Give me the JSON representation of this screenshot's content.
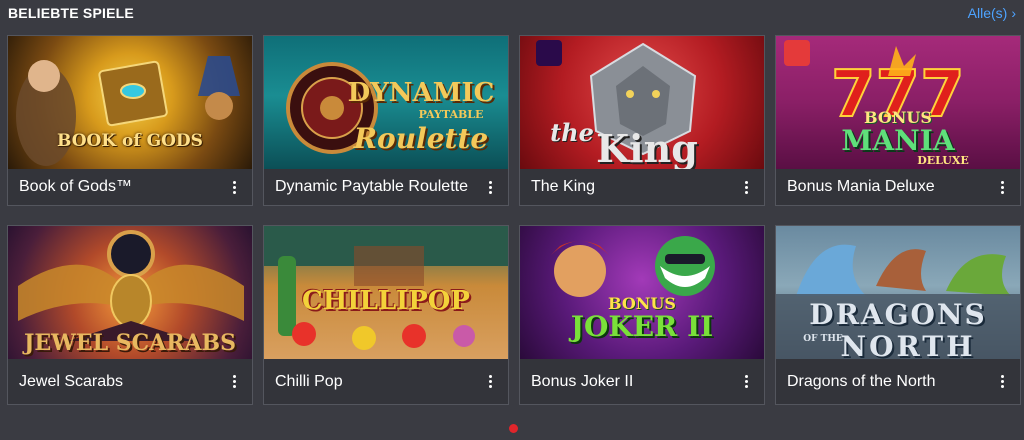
{
  "header": {
    "title": "BELIEBTE SPIELE",
    "see_all": "Alle(s)",
    "see_all_icon": "chevron-right-icon"
  },
  "games": [
    {
      "title": "Book of Gods™",
      "art_text": "BOOK of GODS"
    },
    {
      "title": "Dynamic Paytable Roulette",
      "art_text_1": "DYNAMIC",
      "art_text_2": "PAYTABLE",
      "art_text_3": "Roulette"
    },
    {
      "title": "The King",
      "art_text_1": "the",
      "art_text_2": "King"
    },
    {
      "title": "Bonus Mania Deluxe",
      "art_text_1": "BONUS",
      "art_text_2": "MANIA",
      "art_text_3": "DELUXE"
    },
    {
      "title": "Jewel Scarabs",
      "art_text": "JEWEL SCARABS"
    },
    {
      "title": "Chilli Pop",
      "art_text": "CHILLIPOP"
    },
    {
      "title": "Bonus Joker II",
      "art_text_1": "BONUS",
      "art_text_2": "JOKER II"
    },
    {
      "title": "Dragons of the North",
      "art_text_1": "DRAGONS",
      "art_text_2": "OF THE",
      "art_text_3": "NORTH"
    }
  ],
  "colors": {
    "background": "#3a3b42",
    "accent_link": "#4da3ff",
    "pager_active": "#e0252b"
  }
}
